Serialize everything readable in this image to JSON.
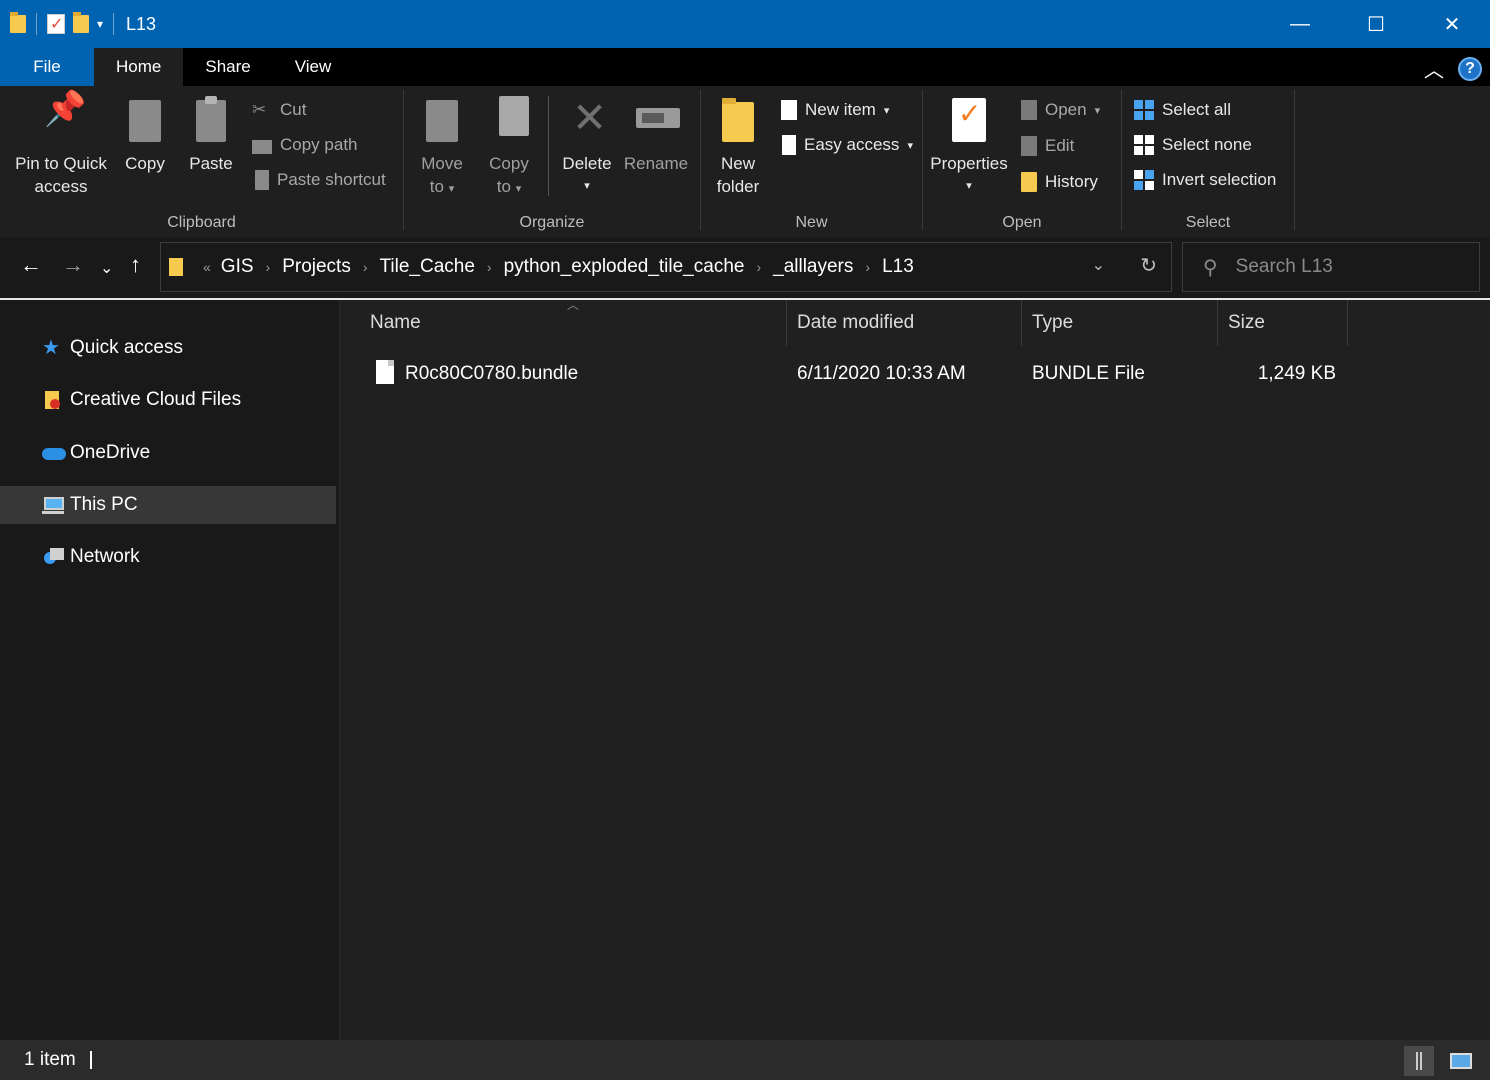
{
  "window": {
    "title": "L13",
    "controls": {
      "minimize": "—",
      "maximize": "☐",
      "close": "✕"
    }
  },
  "tabs": [
    {
      "label": "File"
    },
    {
      "label": "Home"
    },
    {
      "label": "Share"
    },
    {
      "label": "View"
    }
  ],
  "ribbon": {
    "clipboard": {
      "label": "Clipboard",
      "pin_label_1": "Pin to Quick",
      "pin_label_2": "access",
      "copy_label": "Copy",
      "paste_label": "Paste",
      "cut_label": "Cut",
      "copy_path_label": "Copy path",
      "paste_shortcut_label": "Paste shortcut"
    },
    "organize": {
      "label": "Organize",
      "move_label_1": "Move",
      "move_label_2": "to",
      "copy_label_1": "Copy",
      "copy_label_2": "to",
      "delete_label": "Delete",
      "rename_label": "Rename"
    },
    "new": {
      "label": "New",
      "new_folder_1": "New",
      "new_folder_2": "folder",
      "new_item_label": "New item",
      "easy_access_label": "Easy access"
    },
    "open": {
      "label": "Open",
      "properties_label": "Properties",
      "open_label": "Open",
      "edit_label": "Edit",
      "history_label": "History"
    },
    "select": {
      "label": "Select",
      "select_all": "Select all",
      "select_none": "Select none",
      "invert_selection": "Invert selection"
    }
  },
  "address": {
    "overflow": "«",
    "breadcrumbs": [
      "GIS",
      "Projects",
      "Tile_Cache",
      "python_exploded_tile_cache",
      "_alllayers",
      "L13"
    ],
    "separator": "›"
  },
  "search": {
    "placeholder": "Search L13"
  },
  "sidebar": {
    "items": [
      {
        "label": "Quick access",
        "icon": "star-icon"
      },
      {
        "label": "Creative Cloud Files",
        "icon": "creative-cloud-folder-icon"
      },
      {
        "label": "OneDrive",
        "icon": "cloud-icon"
      },
      {
        "label": "This PC",
        "icon": "computer-icon",
        "selected": true
      },
      {
        "label": "Network",
        "icon": "network-icon"
      }
    ]
  },
  "columns": {
    "name": "Name",
    "date": "Date modified",
    "type": "Type",
    "size": "Size"
  },
  "files": [
    {
      "name": "R0c80C0780.bundle",
      "date": "6/11/2020 10:33 AM",
      "type": "BUNDLE File",
      "size": "1,249 KB"
    }
  ],
  "status": {
    "count": "1 item"
  },
  "colors": {
    "titlebar": "#0063b1",
    "background": "#191919",
    "content": "#202020",
    "selected": "#373737"
  }
}
